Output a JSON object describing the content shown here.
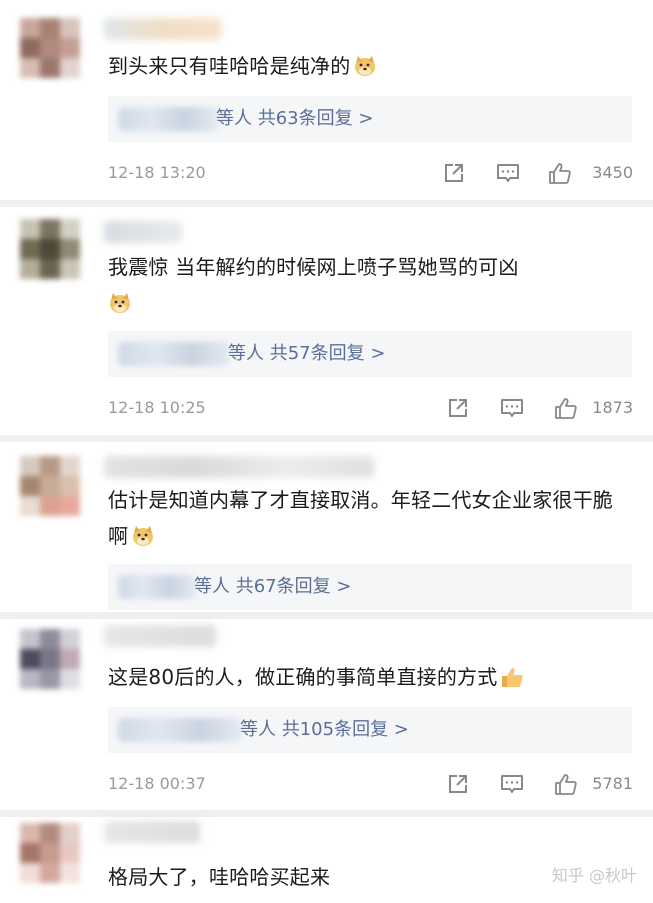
{
  "comments": [
    {
      "content": "到头来只有哇哈哈是纯净的",
      "reply_suffix": "等人",
      "reply_count_text": "共63条回复 >",
      "time": "12-18 13:20",
      "likes": "3450"
    },
    {
      "content": "我震惊 当年解约的时候网上喷子骂她骂的可凶",
      "reply_suffix": "等人",
      "reply_count_text": "共57条回复 >",
      "time": "12-18 10:25",
      "likes": "1873"
    },
    {
      "content": "估计是知道内幕了才直接取消。年轻二代女企业家很干脆啊",
      "reply_suffix": "等人",
      "reply_count_text": "共67条回复 >"
    },
    {
      "content": "这是80后的人，做正确的事简单直接的方式",
      "reply_suffix": "等人",
      "reply_count_text": "共105条回复 >",
      "time": "12-18 00:37",
      "likes": "5781"
    },
    {
      "content": "格局大了，哇哈哈买起来"
    }
  ],
  "watermark": "知乎 @秋叶",
  "icons": [
    "share-icon",
    "comment-icon",
    "thumbs-up-icon",
    "doge-emoji-icon",
    "thumbs-up-emoji-icon"
  ]
}
